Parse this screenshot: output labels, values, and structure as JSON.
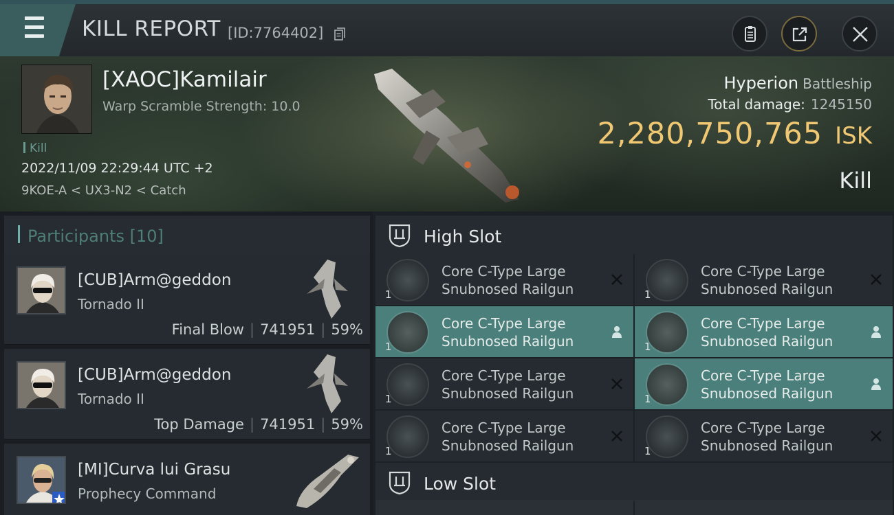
{
  "topbar": {
    "title": "KILL REPORT",
    "report_id": "[ID:7764402]"
  },
  "victim": {
    "name": "[XAOC]Kamilair",
    "warp_scramble": "Warp Scramble Strength: 10.0",
    "tag": "Kill",
    "timestamp": "2022/11/09 22:29:44 UTC +2",
    "location": "9KOE-A < UX3-N2 < Catch",
    "ship_name": "Hyperion",
    "ship_class": "Battleship",
    "total_damage_label": "Total damage:",
    "total_damage": "1245150",
    "isk_value": "2,280,750,765",
    "isk_unit": "ISK",
    "result": "Kill"
  },
  "participants": {
    "title": "Participants [10]",
    "list": [
      {
        "name": "[CUB]Arm@geddon",
        "ship": "Tornado II",
        "role": "Final Blow",
        "damage": "741951",
        "percent": "59%"
      },
      {
        "name": "[CUB]Arm@geddon",
        "ship": "Tornado II",
        "role": "Top Damage",
        "damage": "741951",
        "percent": "59%"
      },
      {
        "name": "[MI]Curva lui Grasu",
        "ship": "Prophecy Command"
      }
    ]
  },
  "fitting": {
    "high_slot_title": "High Slot",
    "low_slot_title": "Low Slot",
    "high_slot": [
      {
        "line1": "Core C-Type Large",
        "line2": "Snubnosed Railgun",
        "qty": "1",
        "status": "destroyed"
      },
      {
        "line1": "Core C-Type Large",
        "line2": "Snubnosed Railgun",
        "qty": "1",
        "status": "destroyed"
      },
      {
        "line1": "Core C-Type Large",
        "line2": "Snubnosed Railgun",
        "qty": "1",
        "status": "dropped"
      },
      {
        "line1": "Core C-Type Large",
        "line2": "Snubnosed Railgun",
        "qty": "1",
        "status": "dropped"
      },
      {
        "line1": "Core C-Type Large",
        "line2": "Snubnosed Railgun",
        "qty": "1",
        "status": "destroyed"
      },
      {
        "line1": "Core C-Type Large",
        "line2": "Snubnosed Railgun",
        "qty": "1",
        "status": "dropped"
      },
      {
        "line1": "Core C-Type Large",
        "line2": "Snubnosed Railgun",
        "qty": "1",
        "status": "destroyed"
      },
      {
        "line1": "Core C-Type Large",
        "line2": "Snubnosed Railgun",
        "qty": "1",
        "status": "destroyed"
      }
    ]
  },
  "colors": {
    "accent_teal": "#4b7f7b",
    "isk_gold": "#f0c873",
    "panel": "#252b30"
  },
  "icons": [
    "menu-icon",
    "copy-icon",
    "clipboard-icon",
    "share-icon",
    "close-icon",
    "high-slot-icon",
    "low-slot-icon",
    "destroyed-x-icon",
    "dropped-person-icon"
  ]
}
